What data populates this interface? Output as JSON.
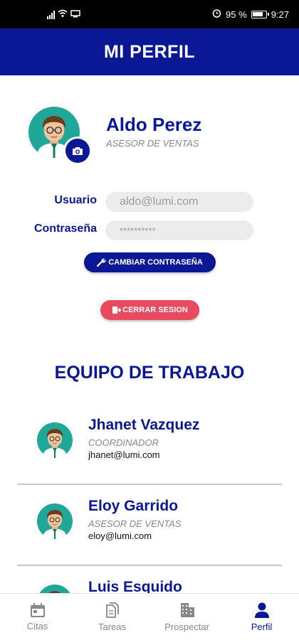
{
  "status_bar": {
    "battery_text": "95 %",
    "time": "9:27"
  },
  "header": {
    "title": "MI PERFIL"
  },
  "profile": {
    "name": "Aldo Perez",
    "role": "ASESOR DE VENTAS",
    "user_label": "Usuario",
    "user_value": "aldo@lumi.com",
    "password_label": "Contraseña",
    "password_value": "**********",
    "change_password_label": "CAMBIAR CONTRASEÑA",
    "logout_label": "CERRAR SESION"
  },
  "team": {
    "title": "EQUIPO DE TRABAJO",
    "members": [
      {
        "name": "Jhanet Vazquez",
        "role": "COORDINADOR",
        "email": "jhanet@lumi.com"
      },
      {
        "name": "Eloy Garrido",
        "role": "ASESOR DE VENTAS",
        "email": "eloy@lumi.com"
      },
      {
        "name": "Luis Esquido",
        "role": "",
        "email": ""
      }
    ]
  },
  "nav": {
    "items": [
      {
        "label": "Citas",
        "icon": "calendar-icon"
      },
      {
        "label": "Tareas",
        "icon": "documents-icon"
      },
      {
        "label": "Prospectar",
        "icon": "building-icon"
      },
      {
        "label": "Perfil",
        "icon": "person-icon"
      }
    ],
    "active": "Perfil"
  },
  "colors": {
    "primary": "#0a1896",
    "danger": "#e84a5f",
    "avatar_bg": "#1fa89a"
  }
}
